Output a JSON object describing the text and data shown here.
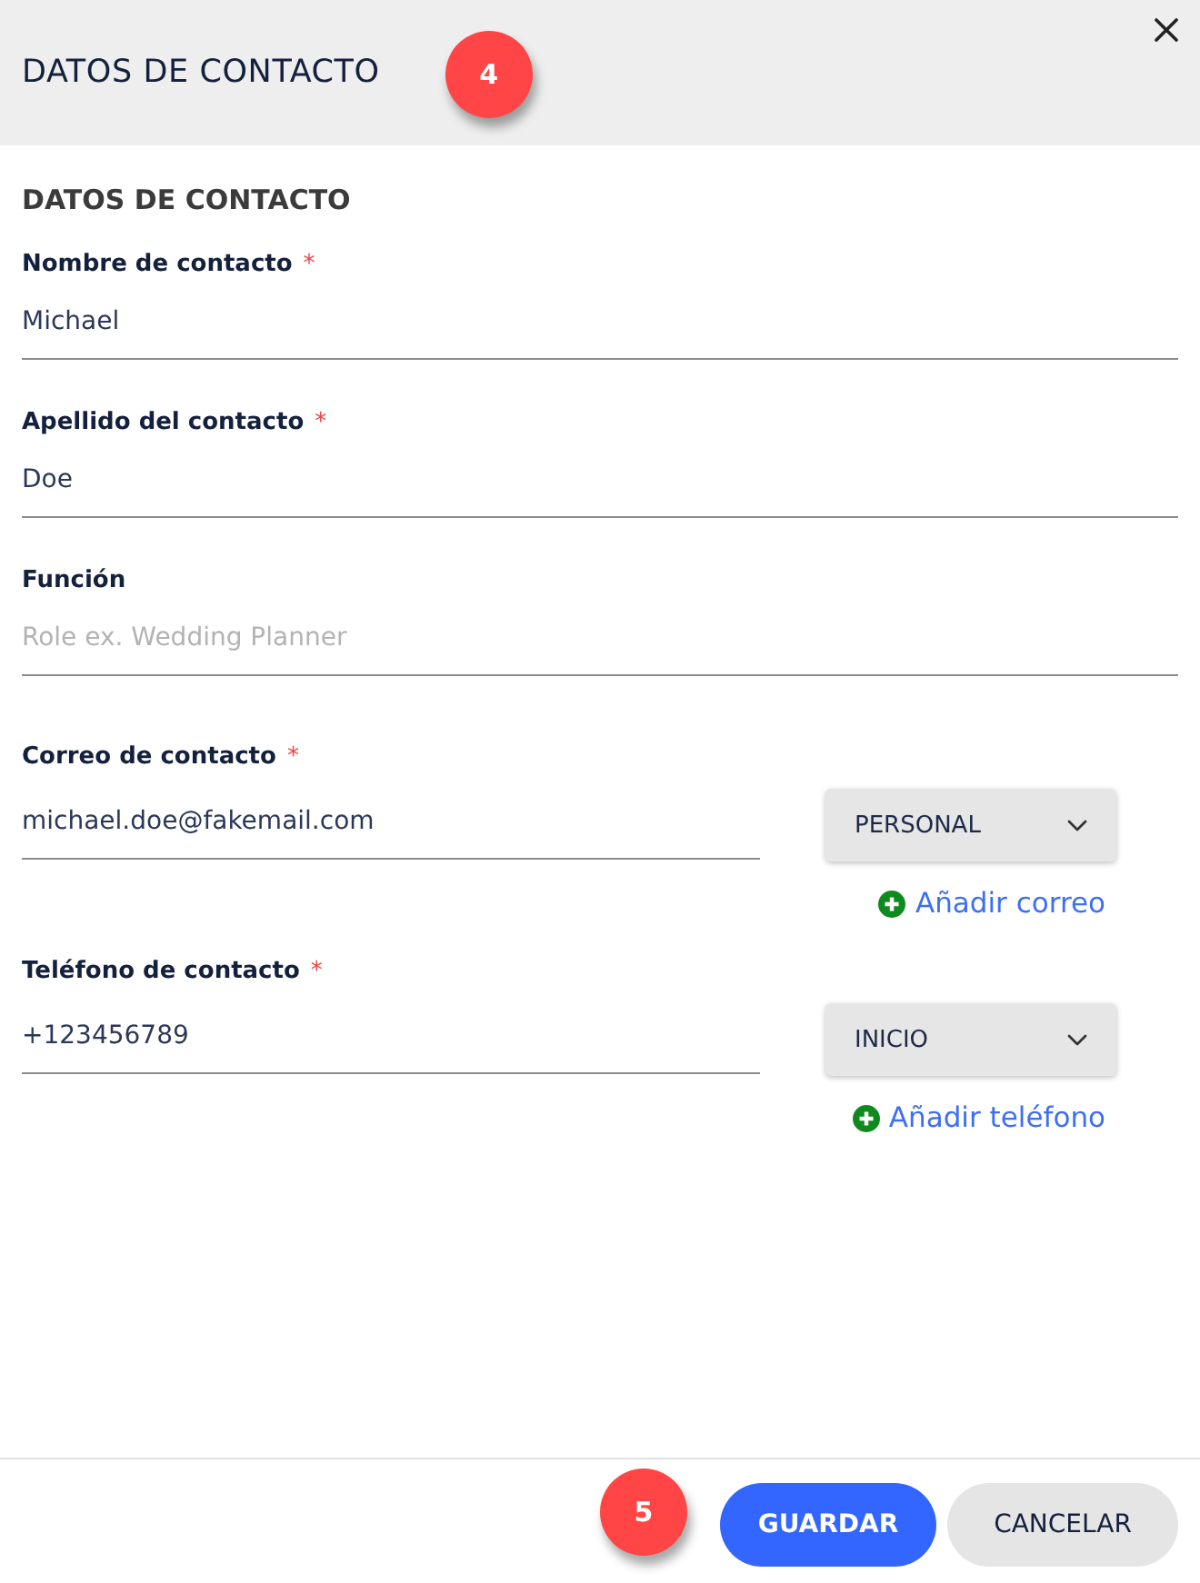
{
  "dialog": {
    "title": "DATOS DE CONTACTO",
    "badge": "4"
  },
  "section": {
    "heading": "DATOS DE CONTACTO"
  },
  "fields": [
    {
      "kind": "text",
      "label": "Nombre de contacto",
      "required_mark": "*",
      "value": "Michael"
    },
    {
      "kind": "text",
      "label": "Apellido del contacto",
      "required_mark": "*",
      "value": "Doe"
    },
    {
      "kind": "text",
      "label": "Función",
      "placeholder": "Role ex. Wedding Planner"
    },
    {
      "kind": "multi",
      "label": "Correo de contacto",
      "required_mark": "*",
      "value": "michael.doe@fakemail.com",
      "type_select": "PERSONAL",
      "add_link": "Añadir correo"
    },
    {
      "kind": "multi",
      "label": "Teléfono de contacto",
      "required_mark": "*",
      "value": "+123456789",
      "type_select": "INICIO",
      "add_link": "Añadir teléfono"
    }
  ],
  "footer": {
    "badge": "5",
    "buttons": [
      {
        "kind": "primary",
        "label": "GUARDAR"
      },
      {
        "kind": "secondary",
        "label": "CANCELAR"
      }
    ]
  }
}
